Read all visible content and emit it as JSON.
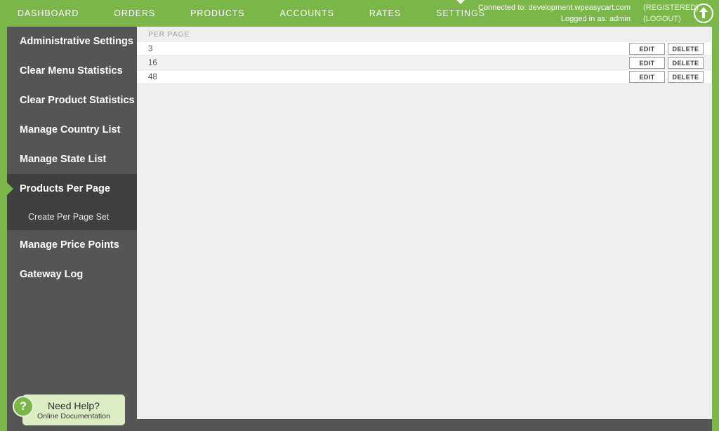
{
  "theme": {
    "accent_green": "#7ab648",
    "sidebar_bg": "#555555",
    "sidebar_active_bg": "#3f3f3f",
    "content_bg": "#efefef"
  },
  "topbar": {
    "nav": [
      {
        "label": "DASHBOARD",
        "active": false
      },
      {
        "label": "ORDERS",
        "active": false
      },
      {
        "label": "PRODUCTS",
        "active": false
      },
      {
        "label": "ACCOUNTS",
        "active": false
      },
      {
        "label": "RATES",
        "active": false
      },
      {
        "label": "SETTINGS",
        "active": true
      }
    ],
    "connected_label": "Connected to: development.wpeasycart.com",
    "registered_label": "(REGISTERED)",
    "logged_in_label": "Logged in as: admin",
    "logout_label": "(LOGOUT)",
    "scroll_top_icon": "arrow-up-icon"
  },
  "sidebar": {
    "items": [
      {
        "label": "Administrative Settings"
      },
      {
        "label": "Clear Menu Statistics"
      },
      {
        "label": "Clear Product Statistics"
      },
      {
        "label": "Manage Country List"
      },
      {
        "label": "Manage State List"
      }
    ],
    "active_group": {
      "label": "Products Per Page",
      "sub_items": [
        {
          "label": "Create Per Page Set"
        }
      ]
    },
    "items_after": [
      {
        "label": "Manage Price Points"
      },
      {
        "label": "Gateway Log"
      }
    ],
    "help": {
      "icon": "question-mark-icon",
      "title": "Need Help?",
      "subtitle": "Online Documentation"
    }
  },
  "main": {
    "table": {
      "columns": [
        "PER PAGE"
      ],
      "rows": [
        {
          "per_page": "3",
          "edit_label": "EDIT",
          "delete_label": "DELETE"
        },
        {
          "per_page": "16",
          "edit_label": "EDIT",
          "delete_label": "DELETE"
        },
        {
          "per_page": "48",
          "edit_label": "EDIT",
          "delete_label": "DELETE"
        }
      ]
    }
  }
}
